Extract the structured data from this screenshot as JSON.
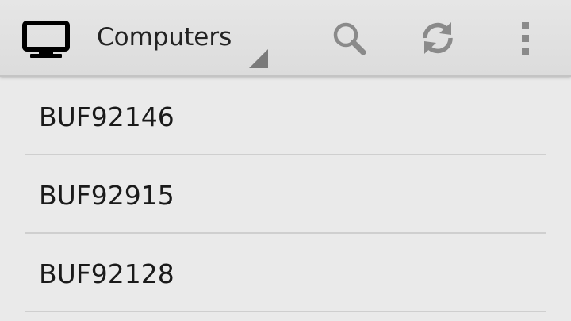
{
  "action_bar": {
    "app_icon": "monitor-icon",
    "nav_title": "Computers",
    "actions": [
      {
        "name": "search",
        "icon": "search-icon"
      },
      {
        "name": "refresh",
        "icon": "refresh-icon"
      },
      {
        "name": "overflow",
        "icon": "overflow-menu-icon"
      }
    ]
  },
  "computers": [
    {
      "label": "BUF92146"
    },
    {
      "label": "BUF92915"
    },
    {
      "label": "BUF92128"
    }
  ],
  "colors": {
    "action_bar": "#dedede",
    "background": "#eaeaea",
    "text": "#222222",
    "icon": "#8a8a8a",
    "divider": "#cfcfcf"
  }
}
